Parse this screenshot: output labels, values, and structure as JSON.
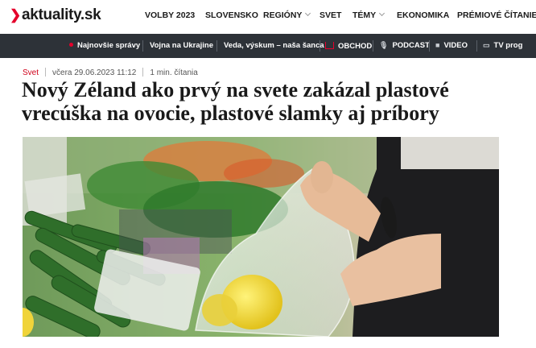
{
  "site": {
    "logo_text": "aktuality.sk",
    "accent": "#e4002b"
  },
  "main_nav": [
    {
      "label": "VOLBY 2023",
      "has_dropdown": false
    },
    {
      "label": "SLOVENSKO",
      "has_dropdown": false
    },
    {
      "label": "REGIÓNY",
      "has_dropdown": true
    },
    {
      "label": "SVET",
      "has_dropdown": false
    },
    {
      "label": "TÉMY",
      "has_dropdown": true
    },
    {
      "label": "EKONOMIKA",
      "has_dropdown": false
    },
    {
      "label": "PRÉMIOVÉ ČÍTANIE",
      "has_dropdown": false
    }
  ],
  "sub_nav": [
    {
      "label": "Najnovšie správy",
      "icon": "live-dot-icon"
    },
    {
      "label": "Vojna na Ukrajine"
    },
    {
      "label": "Veda, výskum – naša šanca"
    },
    {
      "label": "OBCHOD",
      "icon": "shop-icon"
    },
    {
      "label": "PODCAST",
      "icon": "microphone-icon"
    },
    {
      "label": "VIDEO",
      "icon": "video-camera-icon"
    },
    {
      "label": "TV prog",
      "icon": "tv-icon"
    }
  ],
  "article": {
    "category": "Svet",
    "date": "včera 29.06.2023 11:12",
    "read_time": "1 min. čítania",
    "headline": "Nový Zéland ako prvý na svete zakázal plastové vrecúška na ovocie, plastové slamky aj príbory"
  },
  "colors": {
    "subnav_bg": "#2d3238",
    "category": "#d0021b"
  }
}
